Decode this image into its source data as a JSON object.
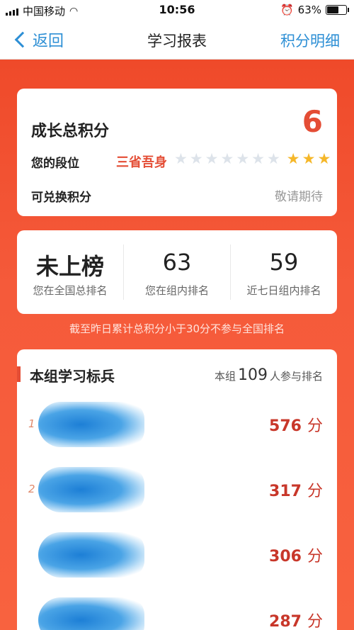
{
  "status_bar": {
    "carrier": "中国移动",
    "time": "10:56",
    "battery": "63%",
    "battery_level": 0.63
  },
  "nav": {
    "back_label": "返回",
    "title": "学习报表",
    "right_link": "积分明细"
  },
  "growth_card": {
    "title": "成长总积分",
    "score": "6",
    "level_label": "您的段位",
    "level_name": "三省吾身",
    "stars_total": 10,
    "stars_filled": 3,
    "redeemable_label": "可兑换积分",
    "redeemable_value": "敬请期待"
  },
  "stats": [
    {
      "value": "未上榜",
      "label": "您在全国总排名"
    },
    {
      "value": "63",
      "label": "您在组内排名"
    },
    {
      "value": "59",
      "label": "近七日组内排名"
    }
  ],
  "note": "截至昨日累计总积分小于30分不参与全国排名",
  "leaderboard": {
    "title": "本组学习标兵",
    "participants_prefix": "本组",
    "participants_count": "109",
    "participants_suffix": "人参与排名",
    "rows": [
      {
        "rank": "1",
        "points": "576",
        "unit": "分"
      },
      {
        "rank": "2",
        "points": "317",
        "unit": "分"
      },
      {
        "rank": "",
        "points": "306",
        "unit": "分"
      },
      {
        "rank": "",
        "points": "287",
        "unit": "分"
      }
    ]
  },
  "colors": {
    "accent_red": "#e44d35",
    "link_blue": "#2d8fd5",
    "star_gold": "#f5b729",
    "background": "#f4472f"
  }
}
